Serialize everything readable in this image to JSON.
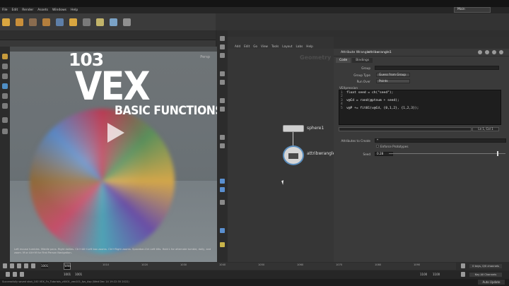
{
  "menu": [
    "File",
    "Edit",
    "Render",
    "Assets",
    "Windows",
    "Help"
  ],
  "desktop": "Main",
  "title_overlay": {
    "number": "103",
    "main": "VEX",
    "sub": "BASIC FUNCTIONS"
  },
  "viewport": {
    "label": "Persp",
    "hint": "Left mouse tumbles. Middle pans. Right dollies. Ctrl+Alt+Left box zooms. Ctrl+Right zooms. Spacebar-Ctrl-Left tilts. Hold L for alternate tumble, dolly, and zoom. M or Alt+M for First Person Navigation."
  },
  "network": {
    "menu": [
      "Add",
      "Edit",
      "Go",
      "View",
      "Tools",
      "Layout",
      "Labs",
      "Help"
    ],
    "context_label": "Geometry",
    "node_sphere": "sphere1",
    "node_wrangle": "attribwrangle1"
  },
  "params": {
    "node_type": "Attribute Wrangle",
    "node_name": "attribwrangle1",
    "tabs": [
      "Code",
      "Bindings"
    ],
    "group_label": "Group",
    "group_type_label": "Group Type",
    "group_type_value": "Guess from Group",
    "run_over_label": "Run Over",
    "run_over_value": "Points",
    "vex_label": "VEXpression",
    "code": [
      {
        "n": "1",
        "t": "float seed = ch(\"seed\");"
      },
      {
        "n": "2",
        "t": ""
      },
      {
        "n": "3",
        "t": "v@Cd = rand(@ptnum + seed);"
      },
      {
        "n": "4",
        "t": ""
      },
      {
        "n": "5",
        "t": "v@P += fit01(v@Cd, {0,1,2}, {1,2,3});"
      }
    ],
    "linecol": "Ln 1, Col 1",
    "attributes_label": "Attributes to Create",
    "attributes_value": "*",
    "enforce_label": "Enforce Prototypes",
    "seed_label": "Seed",
    "seed_value": "0.28",
    "seed_fraction": 0.93
  },
  "timeline": {
    "current_frame": "1001",
    "start": "1001",
    "start2": "1001",
    "end": "1100",
    "end2": "1100",
    "ticks": [
      "1001",
      "1010",
      "1020",
      "1030",
      "1040",
      "1050",
      "1060",
      "1070",
      "1080",
      "1090"
    ],
    "keys_label": "0 keys, 0/0 channels",
    "key_all_label": "Key All Channels",
    "auto_update": "Auto Update"
  },
  "status": "Successfully saved shot_100 VEX_Fn_Tutorials_v0001_vex101_fps_Asp (Wed Dec 14 19:22:35 2022)"
}
